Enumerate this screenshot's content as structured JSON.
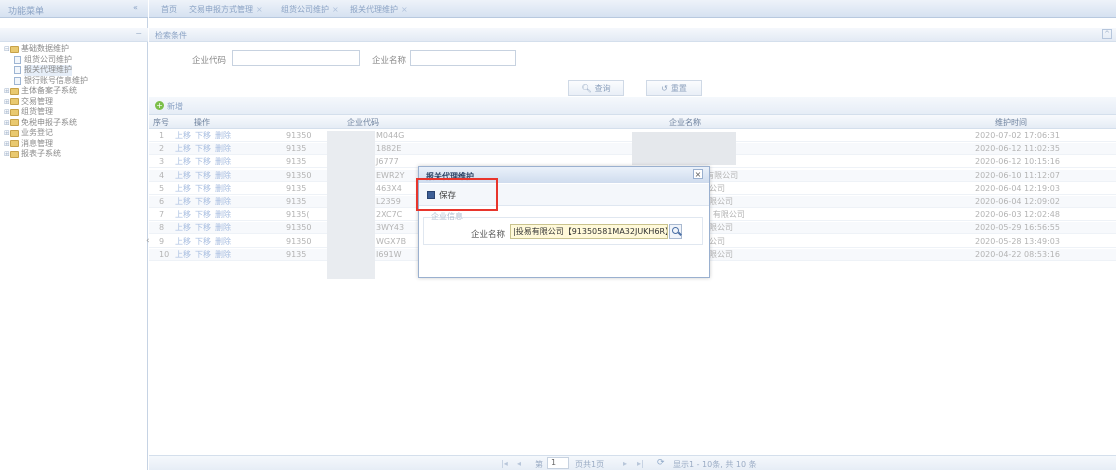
{
  "sidebar": {
    "title": "功能菜单",
    "collapse": "«",
    "tree": [
      {
        "label": "基础数据维护",
        "level": 0,
        "expanded": true
      },
      {
        "label": "组货公司维护",
        "level": 1
      },
      {
        "label": "报关代理维护",
        "level": 1,
        "selected": true
      },
      {
        "label": "银行账号信息维护",
        "level": 1
      },
      {
        "label": "主体备案子系统",
        "level": 0
      },
      {
        "label": "交易管理",
        "level": 0
      },
      {
        "label": "组货管理",
        "level": 0
      },
      {
        "label": "免税申报子系统",
        "level": 0
      },
      {
        "label": "业务登记",
        "level": 0
      },
      {
        "label": "消息管理",
        "level": 0
      },
      {
        "label": "报表子系统",
        "level": 0
      }
    ]
  },
  "tabs": [
    "首页",
    "交易申报方式管理",
    "组货公司维护",
    "报关代理维护"
  ],
  "search": {
    "title": "检索条件",
    "code_label": "企业代码",
    "name_label": "企业名称",
    "query_button": "查询",
    "reset_button": "重置"
  },
  "toolbar": {
    "add_label": "新增"
  },
  "table": {
    "headers": [
      "序号",
      "操作",
      "企业代码",
      "企业名称",
      "维护时间"
    ],
    "actions": [
      "上移",
      "下移",
      "删除"
    ],
    "rows": [
      {
        "no": "1",
        "code_pre": "91350",
        "code_suf": "M044G",
        "name": "",
        "time": "2020-07-02 17:06:31"
      },
      {
        "no": "2",
        "code_pre": "9135",
        "code_suf": "1882E",
        "name": "",
        "time": "2020-06-12 11:02:35"
      },
      {
        "no": "3",
        "code_pre": "9135",
        "code_suf": "J6777",
        "name": "限公司",
        "time": "2020-06-12 10:15:16"
      },
      {
        "no": "4",
        "code_pre": "91350",
        "code_suf": "EWR2Y",
        "name": "5有限公司",
        "time": "2020-06-10 11:12:07"
      },
      {
        "no": "5",
        "code_pre": "9135",
        "code_suf": "463X4",
        "name": "限公司",
        "time": "2020-06-04 12:19:03"
      },
      {
        "no": "6",
        "code_pre": "9135",
        "code_suf": "L2359",
        "name": "有限公司",
        "time": "2020-06-04 12:09:02"
      },
      {
        "no": "7",
        "code_pre": "9135(",
        "code_suf": "2XC7C",
        "name": "D) 有限公司",
        "time": "2020-06-03 12:02:48"
      },
      {
        "no": "8",
        "code_pre": "91350",
        "code_suf": "3WY43",
        "name": "有限公司",
        "time": "2020-05-29 16:56:55"
      },
      {
        "no": "9",
        "code_pre": "91350",
        "code_suf": "WGX7B",
        "name": "限公司",
        "time": "2020-05-28 13:49:03"
      },
      {
        "no": "10",
        "code_pre": "9135",
        "code_suf": "I691W",
        "name": "有限公司",
        "time": "2020-04-22 08:53:16"
      }
    ]
  },
  "pager": {
    "page_label": "第",
    "page_value": "1",
    "total_label": "页共1页",
    "summary": "显示1 - 10条, 共 10 条"
  },
  "dialog": {
    "title": "报关代理维护",
    "close": "×",
    "save_label": "保存",
    "section": "企业信息",
    "field_label": "企业名称",
    "field_value": "|投易有限公司【91350581MA32JUKH6R】"
  },
  "colors": {
    "highlight": "#e8352c",
    "input_bg": "#fff9d9"
  }
}
